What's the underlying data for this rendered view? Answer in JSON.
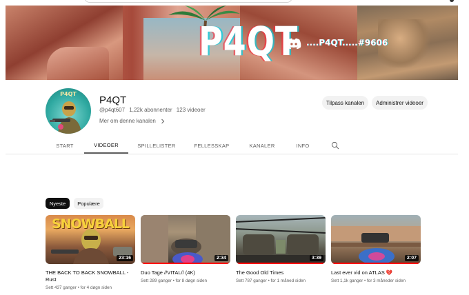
{
  "banner": {
    "title": "P4QT",
    "discord_tag": "....P4QT.....#9606"
  },
  "channel": {
    "avatar_text": "P4QT",
    "name": "P4QT",
    "handle": "@p4qt607",
    "subscribers": "1,22k abonnenter",
    "video_count": "123 videoer",
    "more_link": "Mer om denne kanalen",
    "buttons": {
      "edit": "Tilpass kanalen",
      "manage": "Administrer videoer"
    }
  },
  "tabs": [
    {
      "label": "START"
    },
    {
      "label": "VIDEOER"
    },
    {
      "label": "SPILLELISTER"
    },
    {
      "label": "FELLESSKAP"
    },
    {
      "label": "KANALER"
    },
    {
      "label": "INFO"
    }
  ],
  "active_tab": "VIDEOER",
  "chips": {
    "newest": "Nyeste",
    "popular": "Populære"
  },
  "videos": [
    {
      "title": "THE BACK TO BACK SNOWBALL - Rust",
      "thumb_text": "SNOWBALL",
      "duration": "23:16",
      "views": "Sett 437 ganger",
      "age": "for 4 døgn siden",
      "watched_fraction": 0.0
    },
    {
      "title": "Duo Tage //VITAL// (4K)",
      "thumb_text": "",
      "duration": "2:34",
      "views": "Sett 289 ganger",
      "age": "for 8 døgn siden",
      "watched_fraction": 1.0
    },
    {
      "title": "The Good Old Times",
      "thumb_text": "",
      "duration": "3:39",
      "views": "Sett 787 ganger",
      "age": "for 1 måned siden",
      "watched_fraction": 1.0
    },
    {
      "title": "Last ever vid on ATLAS 💔",
      "thumb_text": "",
      "duration": "2:07",
      "views": "Sett 1,1k ganger",
      "age": "for 3 måneder siden",
      "watched_fraction": 1.0
    }
  ],
  "meta_separator": "•",
  "icons": {
    "discord": "discord-icon",
    "search": "search-icon",
    "chevron": "chevron-right-icon"
  },
  "colors": {
    "progress": "#ff0000",
    "chip_active_bg": "#0f0f0f",
    "pill_bg": "#f2f2f2"
  }
}
